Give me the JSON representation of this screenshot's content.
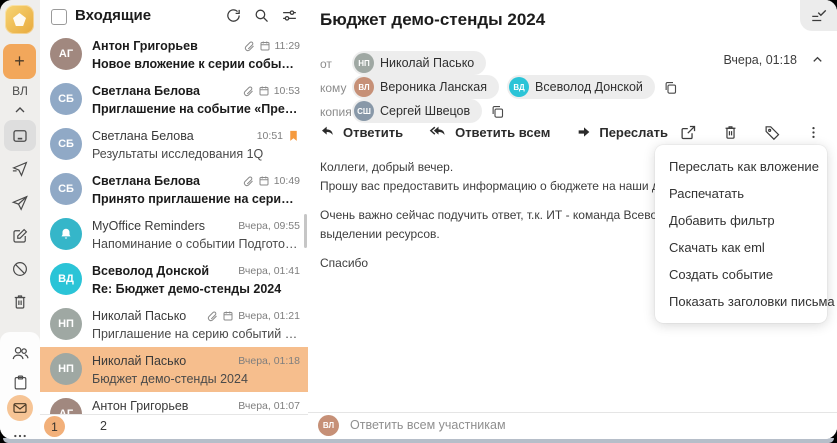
{
  "sidebar": {
    "plus_label": "+",
    "user_initials": "ВЛ",
    "icons": [
      "collapse-up",
      "inbox",
      "sent",
      "outbox",
      "drafts",
      "spam",
      "trash",
      "contacts",
      "calendar",
      "mail",
      "more"
    ]
  },
  "list": {
    "title": "Входящие",
    "header_icons": [
      "refresh",
      "search",
      "filter"
    ],
    "emails": [
      {
        "sender": "Антон Григорьев",
        "subject": "Новое вложение к серии событий «Аналити…",
        "time": "11:29",
        "initials": "АГ"
      },
      {
        "sender": "Светлана Белова",
        "subject": "Приглашение на событие «Предварительно…",
        "time": "10:53",
        "initials": "СБ"
      },
      {
        "sender": "Светлана Белова",
        "subject": "Результаты исследования 1Q",
        "time": "10:51",
        "initials": "СБ"
      },
      {
        "sender": "Светлана Белова",
        "subject": "Принято приглашение на серию событий «…",
        "time": "10:49",
        "initials": "СБ"
      },
      {
        "sender": "MyOffice Reminders",
        "subject": "Напоминание о событии Подготовить отчет…",
        "time": "Вчера, 09:55",
        "initials": ""
      },
      {
        "sender": "Всеволод Донской",
        "subject": "Re: Бюджет демо-стенды 2024",
        "time": "Вчера, 01:41",
        "initials": "ВД"
      },
      {
        "sender": "Николай Пасько",
        "subject": "Приглашение на серию событий «Демо стен…",
        "time": "Вчера, 01:21",
        "initials": "НП"
      },
      {
        "sender": "Николай Пасько",
        "subject": "Бюджет демо-стенды 2024",
        "time": "Вчера, 01:18",
        "initials": "НП"
      },
      {
        "sender": "Антон Григорьев",
        "subject": "",
        "time": "Вчера, 01:07",
        "initials": "АГ"
      }
    ],
    "pagination": {
      "page1": "1",
      "page2": "2",
      "current": "1"
    }
  },
  "message": {
    "title": "Бюджет демо-стенды 2024",
    "time": "Вчера, 01:18",
    "from_label": "от",
    "to_label": "кому",
    "cc_label": "копия",
    "from": {
      "name": "Николай Пасько",
      "initials": "НП"
    },
    "to": [
      {
        "name": "Вероника Ланская",
        "initials": "ВЛ"
      },
      {
        "name": "Всеволод Донской",
        "initials": "ВД"
      }
    ],
    "cc": [
      {
        "name": "Сергей Швецов",
        "initials": "СШ"
      }
    ],
    "toolbar": {
      "reply": "Ответить",
      "reply_all": "Ответить всем",
      "forward": "Переслать"
    },
    "body": {
      "p1l1": "Коллеги, добрый вечер.",
      "p1l2": "Прошу вас предоставить информацию о бюджете на наши демонстраци",
      "p2l1": "Очень важно сейчас подучить ответ, т.к. ИТ - команда Всеволода, уже",
      "p2l2": "выделении ресурсов.",
      "p3": "Спасибо"
    },
    "reply_bar": {
      "placeholder": "Ответить всем участникам",
      "user_initials": "ВЛ"
    }
  },
  "context_menu": {
    "items": [
      "Переслать как вложение",
      "Распечатать",
      "Добавить фильтр",
      "Скачать как eml",
      "Создать событие",
      "Показать заголовки письма"
    ]
  },
  "colors": {
    "accent_orange": "#F2A75B",
    "selected_row": "#F6BE8D",
    "flag_orange": "#F59A3E",
    "teal_avatar": "#2BC4D7",
    "reminder_teal": "#35B6C9",
    "window_edge": "#B6BEC9"
  }
}
